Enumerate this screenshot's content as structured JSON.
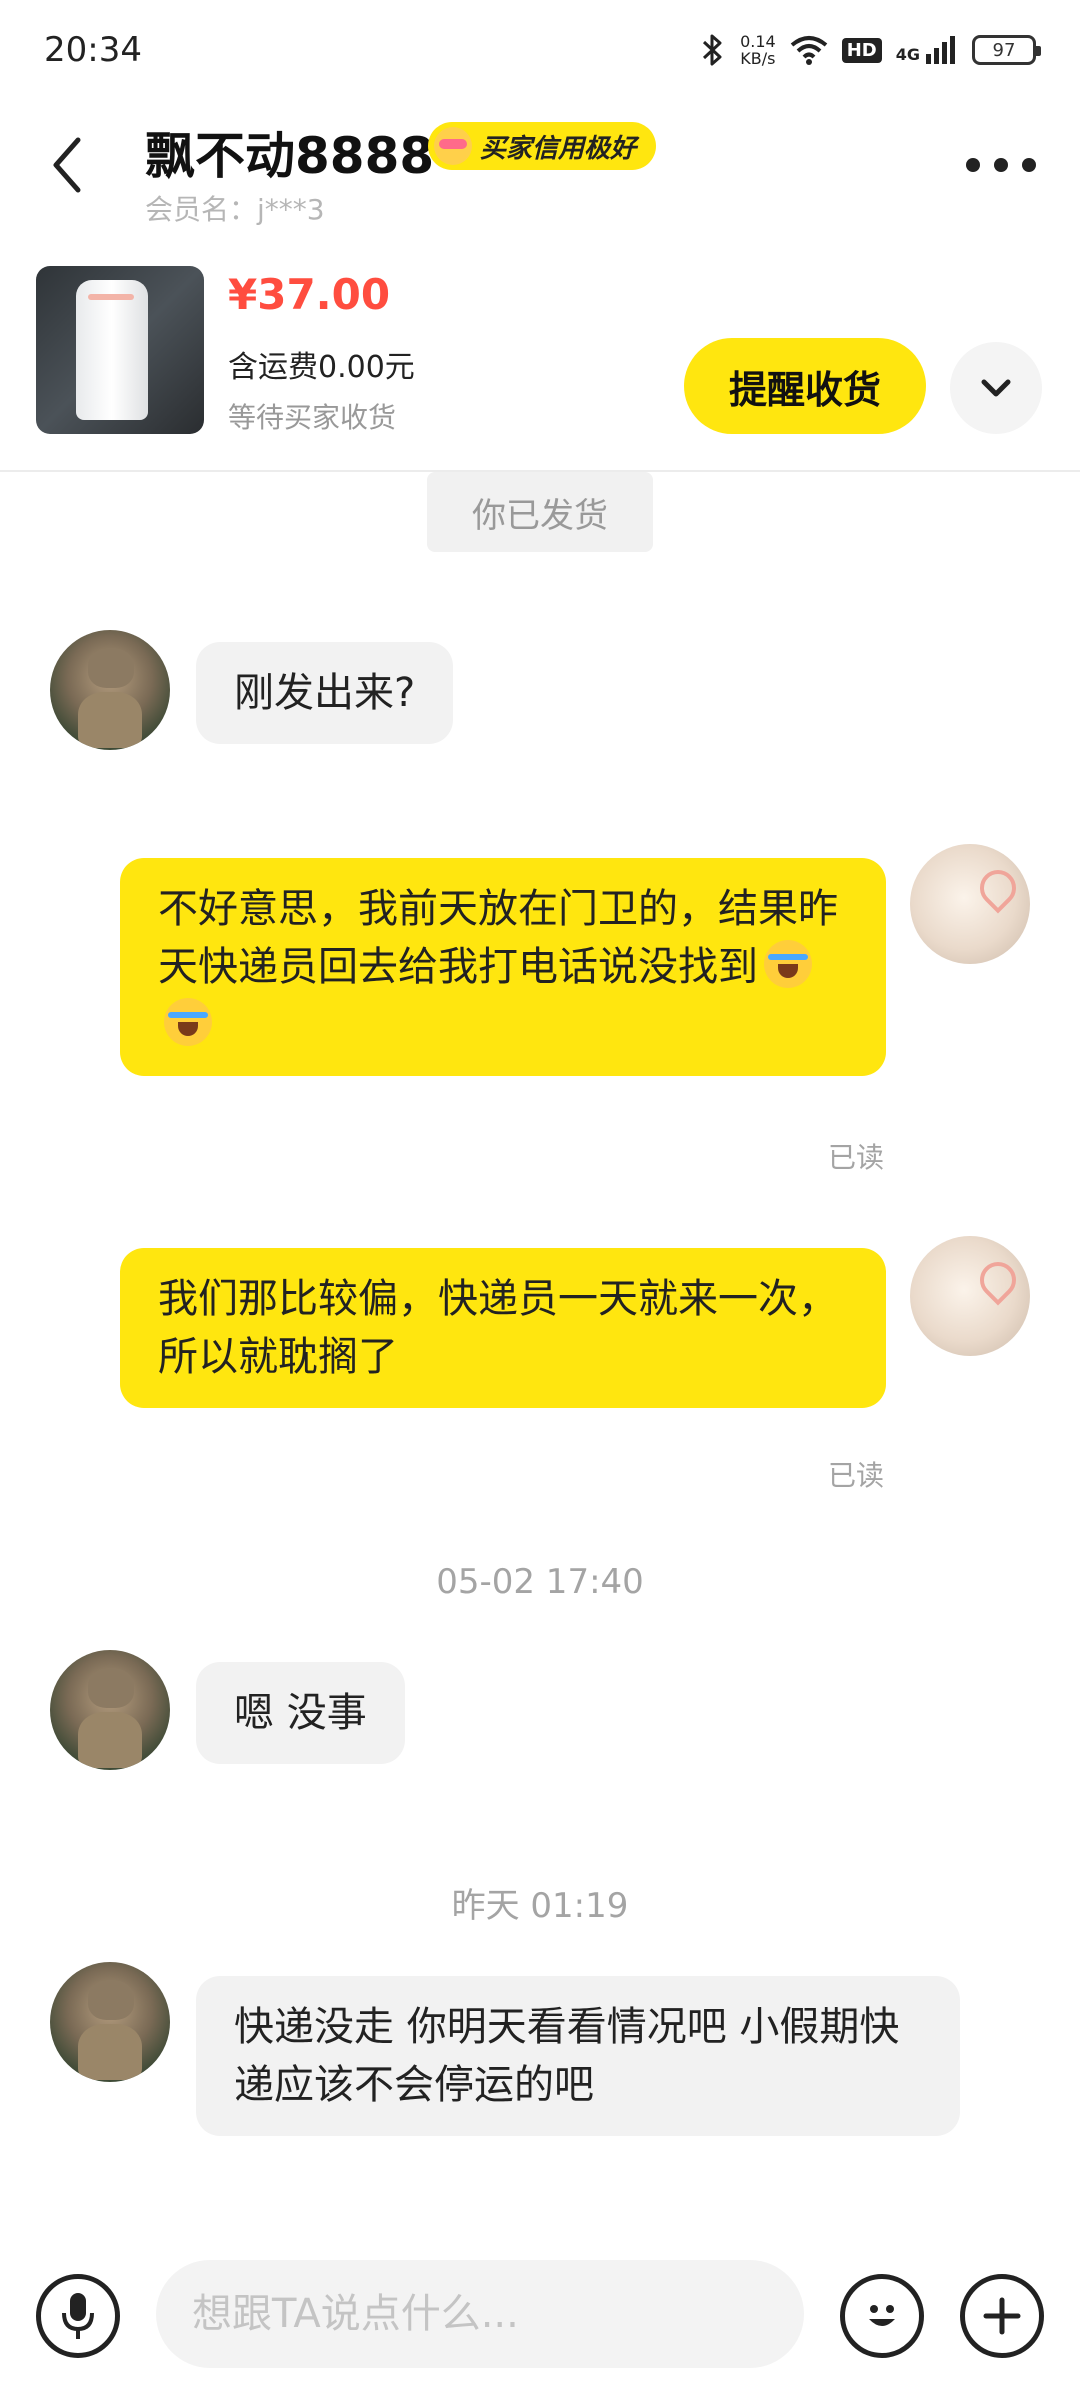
{
  "status_bar": {
    "time": "20:34",
    "net_speed_value": "0.14",
    "net_speed_unit": "KB/s",
    "hd": "HD",
    "network": "4G",
    "battery": "97"
  },
  "header": {
    "name": "飘不动8888",
    "credit_badge": "买家信用极好",
    "member_id": "会员名：j***3"
  },
  "product": {
    "price": "¥37.00",
    "shipping": "含运费0.00元",
    "status": "等待买家收货",
    "remind_button": "提醒收货"
  },
  "chat": {
    "system_notice": "你已发货",
    "messages": [
      {
        "side": "in",
        "text": "刚发出来?"
      },
      {
        "side": "out",
        "text": "不好意思，我前天放在门卫的，结果昨天快递员回去给我打电话说没找到",
        "read": "已读"
      },
      {
        "side": "out",
        "text": "我们那比较偏，快递员一天就来一次，所以就耽搁了",
        "read": "已读"
      },
      {
        "side": "in",
        "text": "嗯 没事"
      },
      {
        "side": "in",
        "text": "快递没走 你明天看看情况吧 小假期快递应该不会停运的吧"
      }
    ],
    "timestamps": [
      "05-02 17:40",
      "昨天 01:19"
    ]
  },
  "input_bar": {
    "placeholder": "想跟TA说点什么..."
  }
}
